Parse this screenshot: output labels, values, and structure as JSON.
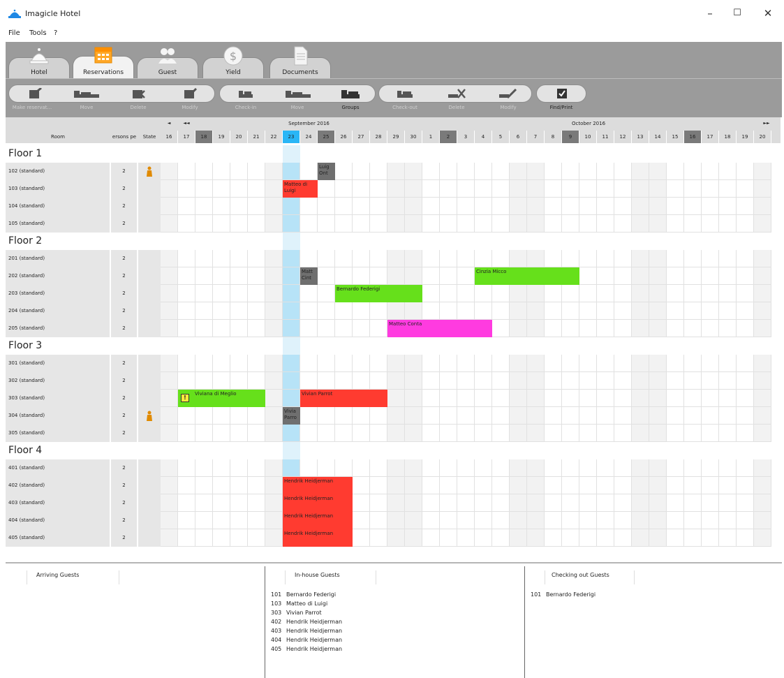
{
  "app": {
    "title": "Imagicle Hotel"
  },
  "window_controls": {
    "minimize": "–",
    "maximize": "☐",
    "close": "✕"
  },
  "menu": [
    "File",
    "Tools",
    "?"
  ],
  "tabs": [
    {
      "label": "Hotel",
      "icon": "bell-icon",
      "active": false
    },
    {
      "label": "Reservations",
      "icon": "calendar-icon",
      "active": true
    },
    {
      "label": "Guest",
      "icon": "people-icon",
      "active": false
    },
    {
      "label": "Yield",
      "icon": "dollar-icon",
      "active": false
    },
    {
      "label": "Documents",
      "icon": "document-icon",
      "active": false
    }
  ],
  "toolbar": [
    {
      "label": "Make reservat...",
      "icon": "reserve-icon",
      "enabled": false
    },
    {
      "label": "Move",
      "icon": "move-bed-icon",
      "enabled": false
    },
    {
      "label": "Delete",
      "icon": "delete-icon",
      "enabled": false
    },
    {
      "label": "Modify",
      "icon": "modify-icon",
      "enabled": false
    },
    {
      "label": "Check-in",
      "icon": "checkin-icon",
      "enabled": false
    },
    {
      "label": "Move",
      "icon": "move-bed-icon",
      "enabled": false
    },
    {
      "label": "Groups",
      "icon": "groups-icon",
      "enabled": true
    },
    {
      "label": "Check-out",
      "icon": "checkout-icon",
      "enabled": false
    },
    {
      "label": "Delete",
      "icon": "delete-bed-icon",
      "enabled": false
    },
    {
      "label": "Modify",
      "icon": "modify-bed-icon",
      "enabled": false
    },
    {
      "label": "Find/Print",
      "icon": "checkbox-icon",
      "enabled": true
    }
  ],
  "grid": {
    "headers": {
      "room": "Room",
      "persons": "ersons pe",
      "state": "State"
    },
    "nav": {
      "prev": "◄",
      "prev_fast": "◄◄",
      "next_fast": "►►"
    },
    "months": [
      {
        "label": "September 2016"
      },
      {
        "label": "October 2016"
      }
    ],
    "days": [
      "16",
      "17",
      "18",
      "19",
      "20",
      "21",
      "22",
      "23",
      "24",
      "25",
      "26",
      "27",
      "28",
      "29",
      "30",
      "1",
      "2",
      "3",
      "4",
      "5",
      "6",
      "7",
      "8",
      "9",
      "10",
      "11",
      "12",
      "13",
      "14",
      "15",
      "16",
      "17",
      "18",
      "19",
      "20"
    ],
    "dark_days": [
      2,
      9,
      16,
      23,
      30
    ],
    "today_index": 7,
    "weekend_days": [
      0,
      6,
      7,
      13,
      14,
      20,
      21,
      27,
      28,
      34
    ],
    "floors": [
      {
        "label": "Floor 1",
        "rooms": [
          {
            "room": "102 (standard)",
            "persons": "2",
            "state": "person"
          },
          {
            "room": "103 (standard)",
            "persons": "2",
            "state": ""
          },
          {
            "room": "104 (standard)",
            "persons": "2",
            "state": ""
          },
          {
            "room": "105 (standard)",
            "persons": "2",
            "state": ""
          }
        ]
      },
      {
        "label": "Floor 2",
        "rooms": [
          {
            "room": "201 (standard)",
            "persons": "2",
            "state": ""
          },
          {
            "room": "202 (standard)",
            "persons": "2",
            "state": ""
          },
          {
            "room": "203 (standard)",
            "persons": "2",
            "state": ""
          },
          {
            "room": "204 (standard)",
            "persons": "2",
            "state": ""
          },
          {
            "room": "205 (standard)",
            "persons": "2",
            "state": ""
          }
        ]
      },
      {
        "label": "Floor 3",
        "rooms": [
          {
            "room": "301 (standard)",
            "persons": "2",
            "state": ""
          },
          {
            "room": "302 (standard)",
            "persons": "2",
            "state": ""
          },
          {
            "room": "303 (standard)",
            "persons": "2",
            "state": ""
          },
          {
            "room": "304 (standard)",
            "persons": "2",
            "state": "person"
          },
          {
            "room": "305 (standard)",
            "persons": "2",
            "state": ""
          }
        ]
      },
      {
        "label": "Floor 4",
        "rooms": [
          {
            "room": "401 (standard)",
            "persons": "2",
            "state": ""
          },
          {
            "room": "402 (standard)",
            "persons": "2",
            "state": ""
          },
          {
            "room": "403 (standard)",
            "persons": "2",
            "state": ""
          },
          {
            "room": "404 (standard)",
            "persons": "2",
            "state": ""
          },
          {
            "room": "405 (standard)",
            "persons": "2",
            "state": ""
          }
        ]
      }
    ],
    "bookings": [
      {
        "room": "102 (standard)",
        "start": 9,
        "days": 1,
        "name": "Luig\nOnt",
        "color": "#6f6f6f"
      },
      {
        "room": "103 (standard)",
        "start": 7,
        "days": 2,
        "name": "Matteo di\nLuigi",
        "color": "#ff3b30"
      },
      {
        "room": "202 (standard)",
        "start": 8,
        "days": 1,
        "name": "Matt\nCint",
        "color": "#6f6f6f"
      },
      {
        "room": "202 (standard)",
        "start": 18,
        "days": 6,
        "name": "Cinzia Micco",
        "color": "#66e01b"
      },
      {
        "room": "203 (standard)",
        "start": 10,
        "days": 5,
        "name": "Bernardo Federigi",
        "color": "#66e01b"
      },
      {
        "room": "205 (standard)",
        "start": 13,
        "days": 6,
        "name": "Matteo Conta",
        "color": "#ff3be0"
      },
      {
        "room": "303 (standard)",
        "start": 1,
        "days": 5,
        "name": "Viviana di Meglio",
        "color": "#66e01b",
        "warning": true
      },
      {
        "room": "303 (standard)",
        "start": 8,
        "days": 5,
        "name": "Vivian Parrot",
        "color": "#ff3b30"
      },
      {
        "room": "304 (standard)",
        "start": 7,
        "days": 1,
        "name": "Vivia\nParro",
        "color": "#6f6f6f"
      },
      {
        "room": "402 (standard)",
        "start": 7,
        "days": 4,
        "name": "Hendrik Heidjerman",
        "color": "#ff3b30"
      },
      {
        "room": "403 (standard)",
        "start": 7,
        "days": 4,
        "name": "Hendrik Heidjerman",
        "color": "#ff3b30"
      },
      {
        "room": "404 (standard)",
        "start": 7,
        "days": 4,
        "name": "Hendrik Heidjerman",
        "color": "#ff3b30"
      },
      {
        "room": "405 (standard)",
        "start": 7,
        "days": 4,
        "name": "Hendrik Heidjerman",
        "color": "#ff3b30"
      }
    ]
  },
  "panels": {
    "arriving": {
      "title": "Arriving Guests",
      "guests": []
    },
    "inhouse": {
      "title": "In-house Guests",
      "guests": [
        {
          "room": "101",
          "name": "Bernardo Federigi"
        },
        {
          "room": "103",
          "name": "Matteo di Luigi"
        },
        {
          "room": "303",
          "name": "Vivian Parrot"
        },
        {
          "room": "402",
          "name": "Hendrik Heidjerman"
        },
        {
          "room": "403",
          "name": "Hendrik Heidjerman"
        },
        {
          "room": "404",
          "name": "Hendrik Heidjerman"
        },
        {
          "room": "405",
          "name": "Hendrik Heidjerman"
        }
      ]
    },
    "checkout": {
      "title": "Checking out Guests",
      "guests": [
        {
          "room": "101",
          "name": "Bernardo Federigi"
        }
      ]
    }
  },
  "colors": {
    "today": "#b7e3f7",
    "today_header": "#29b6f6",
    "weekend": "#f2f2f2",
    "dark_day": "#7a7a7a"
  }
}
